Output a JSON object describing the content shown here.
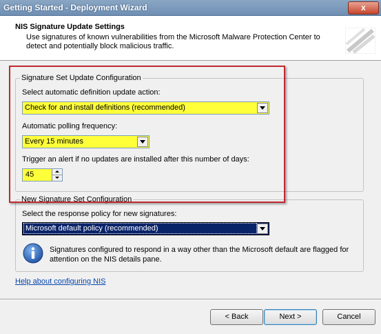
{
  "window": {
    "title": "Getting Started - Deployment Wizard",
    "close_label": "x"
  },
  "header": {
    "title": "NIS Signature Update Settings",
    "description": "Use signatures of known vulnerabilities from the Microsoft Malware Protection Center to detect and potentially block malicious traffic."
  },
  "signature_update": {
    "legend": "Signature Set Update Configuration",
    "action_label": "Select automatic definition update action:",
    "action_value": "Check for and install definitions (recommended)",
    "polling_label": "Automatic polling frequency:",
    "polling_value": "Every 15 minutes",
    "alert_label": "Trigger an alert if no updates are installed after this number of days:",
    "alert_days": "45"
  },
  "new_signature": {
    "legend": "New Signature Set Configuration",
    "policy_label": "Select the response policy for new signatures:",
    "policy_value": "Microsoft default policy (recommended)",
    "info_text": "Signatures configured to respond in a way other than the Microsoft default are flagged for attention on the NIS details pane."
  },
  "help_link": "Help about configuring NIS",
  "buttons": {
    "back": "< Back",
    "next": "Next >",
    "cancel": "Cancel"
  },
  "colors": {
    "highlight_field": "#ffff3a",
    "annotation_box": "#c0282f",
    "selected": "#0a246a"
  }
}
